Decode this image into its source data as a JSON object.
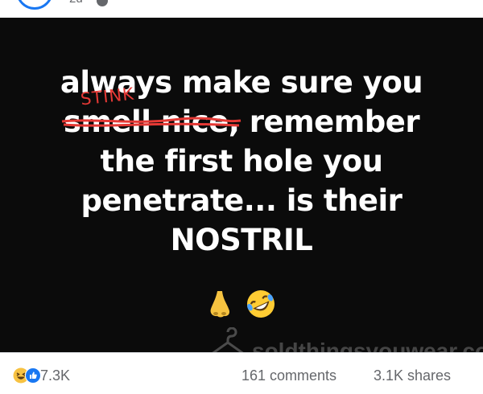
{
  "post": {
    "timestamp": "2d",
    "image": {
      "lines": [
        "always make sure you",
        ", remember",
        "the first hole you",
        "penetrate... is their",
        "NOSTRIL"
      ],
      "struck_text": "smell nice",
      "correction": "STINK",
      "emojis": [
        "nose-emoji",
        "rolling-on-floor-laughing-emoji"
      ],
      "watermark_text": "soldthingsyouwear.com"
    }
  },
  "engagement": {
    "reactions": [
      "laughing-emoji",
      "like-icon"
    ],
    "reaction_count": "7.3K",
    "comments": "161 comments",
    "shares": "3.1K shares"
  },
  "colors": {
    "image_bg": "#0b0b0b",
    "text": "#ffffff",
    "correction": "#e53935",
    "meta_text": "#65676b",
    "brand_blue": "#1877f2"
  }
}
